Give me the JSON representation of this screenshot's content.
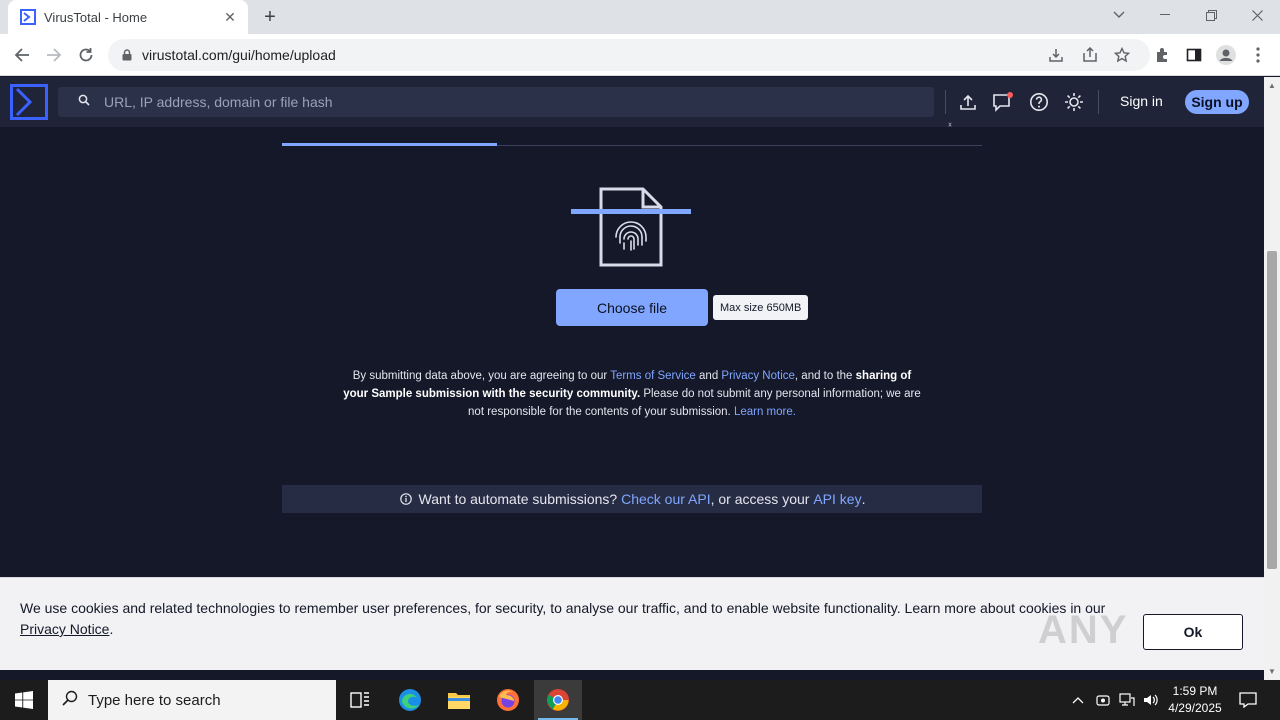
{
  "browser": {
    "tab_title": "VirusTotal - Home",
    "new_tab": "+",
    "url": "virustotal.com/gui/home/upload"
  },
  "header": {
    "search_placeholder": "URL, IP address, domain or file hash",
    "sign_in": "Sign in",
    "sign_up": "Sign up"
  },
  "upload": {
    "choose_file": "Choose file",
    "max_size": "Max size 650MB"
  },
  "terms": {
    "t1": "By submitting data above, you are agreeing to our ",
    "terms_link": "Terms of Service",
    "t2": " and ",
    "privacy_link": "Privacy Notice",
    "t3": ", and to the ",
    "bold": "sharing of your Sample submission with the security community.",
    "t4": " Please do not submit any personal information; we are not responsible for the contents of your submission. ",
    "learn_more": "Learn more."
  },
  "automate": {
    "t1": "Want to automate submissions? ",
    "api_link": "Check our API",
    "t2": ", or access your ",
    "key_link": "API key",
    "t3": "."
  },
  "cookie": {
    "text": "We use cookies and related technologies to remember user preferences, for security, to analyse our traffic, and to enable website functionality. Learn more about cookies in our ",
    "link": "Privacy Notice",
    "end": ".",
    "ok": "Ok",
    "watermark": "ANY RUN"
  },
  "taskbar": {
    "search_placeholder": "Type here to search",
    "time": "1:59 PM",
    "date": "4/29/2025"
  },
  "colors": {
    "accent": "#80a6ff",
    "page_bg": "#141828",
    "header_bg": "#1f2438"
  }
}
